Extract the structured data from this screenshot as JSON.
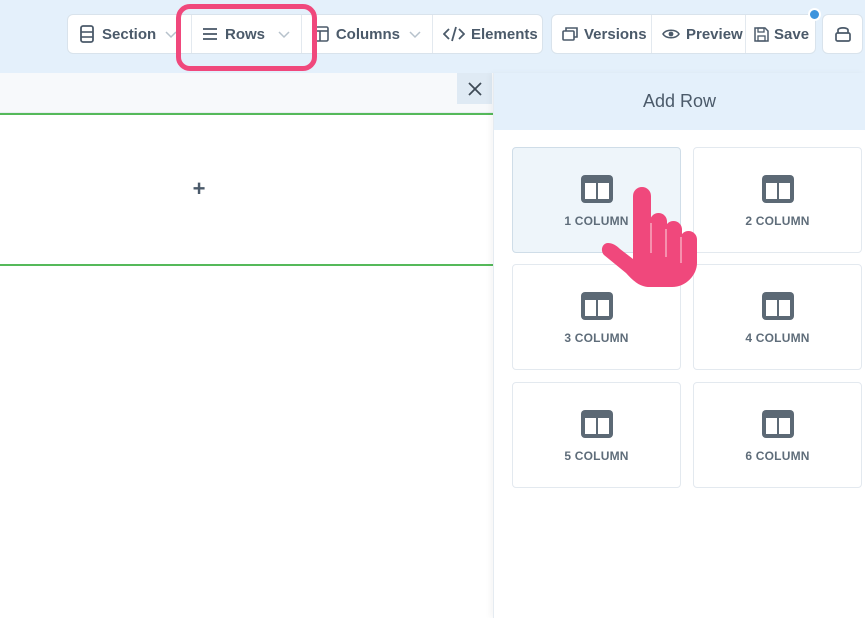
{
  "toolbar": {
    "section_label": "Section",
    "rows_label": "Rows",
    "columns_label": "Columns",
    "elements_label": "Elements",
    "versions_label": "Versions",
    "preview_label": "Preview",
    "save_label": "Save"
  },
  "canvas": {
    "add_symbol": "+"
  },
  "panel": {
    "title": "Add Row",
    "options": [
      {
        "label": "1 COLUMN"
      },
      {
        "label": "2 COLUMN"
      },
      {
        "label": "3 COLUMN"
      },
      {
        "label": "4 COLUMN"
      },
      {
        "label": "5 COLUMN"
      },
      {
        "label": "6 COLUMN"
      }
    ]
  },
  "colors": {
    "accent_pink": "#f0487c",
    "row_border_green": "#55b95a",
    "topbar_bg": "#e4f0fb",
    "notification_blue": "#3d94dd"
  }
}
